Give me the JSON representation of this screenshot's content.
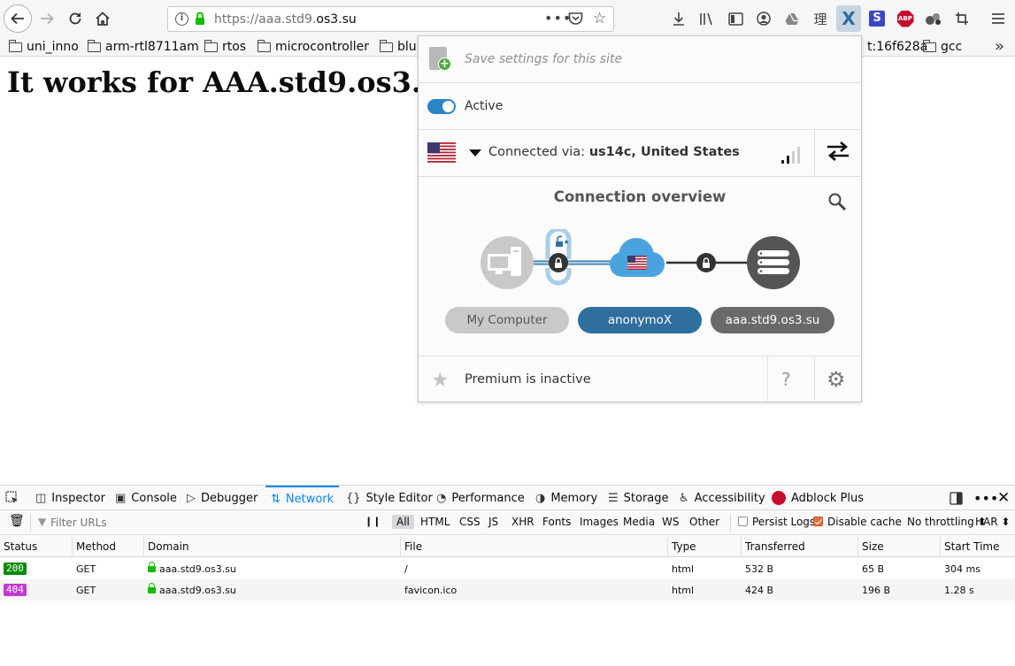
{
  "browser": {
    "url_prefix": "https://aaa.std9.",
    "url_domain": "os3.su",
    "url_dots": "•••",
    "bookmarks": [
      "uni_inno",
      "arm-rtl8711am",
      "rtos",
      "microcontroller",
      "blu",
      "t:16f628a",
      "gcc"
    ],
    "bookmarks_more": "»",
    "ext_anonx": "X",
    "ext_s": "S",
    "ext_abp": "ABP",
    "ext_kanji": "理"
  },
  "page": {
    "heading": "It works for AAA.std9.os3."
  },
  "anonymox": {
    "save_label": "Save settings for this site",
    "active_label": "Active",
    "active": true,
    "connected_prefix": "Connected via: ",
    "connected_server": "us14c, United States",
    "overview_title": "Connection overview",
    "node_computer": "My Computer",
    "node_proxy": "anonymoX",
    "node_site": "aaa.std9.os3.su",
    "premium_label": "Premium is inactive",
    "help_label": "?",
    "accent_color": "#2e6f9e"
  },
  "devtools": {
    "tabs": [
      "Inspector",
      "Console",
      "Debugger",
      "Network",
      "Style Editor",
      "Performance",
      "Memory",
      "Storage",
      "Accessibility",
      "Adblock Plus"
    ],
    "selected_tab": "Network",
    "filter_placeholder": "Filter URLs",
    "type_filters": [
      "All",
      "HTML",
      "CSS",
      "JS",
      "XHR",
      "Fonts",
      "Images",
      "Media",
      "WS",
      "Other"
    ],
    "persist_logs": "Persist Logs",
    "disable_cache": "Disable cache",
    "throttling": "No throttling ⬍",
    "har": "HAR ⬍",
    "columns": [
      "Status",
      "Method",
      "Domain",
      "File",
      "Type",
      "Transferred",
      "Size",
      "Start Time"
    ],
    "rows": [
      {
        "status": "200",
        "method": "GET",
        "domain": "aaa.std9.os3.su",
        "file": "/",
        "type": "html",
        "transferred": "532 B",
        "size": "65 B",
        "start": "304 ms"
      },
      {
        "status": "404",
        "method": "GET",
        "domain": "aaa.std9.os3.su",
        "file": "favicon.ico",
        "type": "html",
        "transferred": "424 B",
        "size": "196 B",
        "start": "1.28 s"
      }
    ],
    "status_colors": {
      "200": "#058b00",
      "404": "#c238d4"
    }
  }
}
